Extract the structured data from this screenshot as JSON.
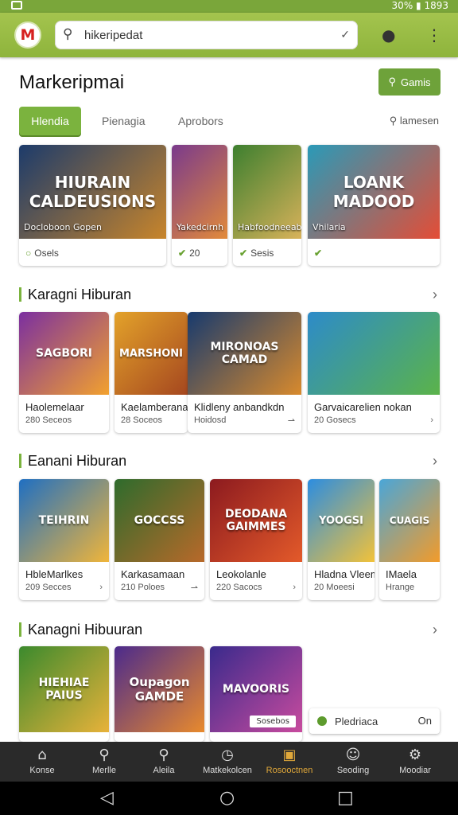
{
  "status": {
    "right": "30% ▮ 1893"
  },
  "app": {
    "logo_letter": "M",
    "search_value": "hikeripedat"
  },
  "page": {
    "title": "Markeripmai",
    "games_button": "Gamis"
  },
  "tabs": {
    "items": [
      "Hlendia",
      "Pienagia",
      "Aprobors"
    ],
    "right_label": "lamesen"
  },
  "featured": [
    {
      "art": "HIURAIN CALDEUSIONS",
      "art_label": "Docloboon Gopen",
      "footer": "Osels",
      "colors": [
        "#1c3b6b",
        "#c8852b"
      ]
    },
    {
      "art": "",
      "art_label": "Yakedcirnh",
      "footer": "20",
      "colors": [
        "#7a3a8c",
        "#e28a3a"
      ]
    },
    {
      "art": "",
      "art_label": "Habfoodneeab",
      "footer": "Sesis",
      "colors": [
        "#3d7f2f",
        "#d8b25a"
      ]
    },
    {
      "art": "LOANK MADOOD",
      "art_label": "Vhilaria",
      "footer": "",
      "colors": [
        "#2a9ab8",
        "#e44d36"
      ]
    }
  ],
  "sections": [
    {
      "title": "Karagni Hiburan",
      "cards": [
        {
          "art": "SAGBORI",
          "title": "Haolemelaar",
          "sub": "280 Seceos",
          "colors": [
            "#7b2fa0",
            "#f2a12e"
          ]
        },
        {
          "art": "MARSHONI",
          "title": "Kaelamberana",
          "sub": "28 Soceos",
          "colors": [
            "#e3a22a",
            "#a5471f"
          ]
        },
        {
          "art": "MIRONOAS CAMAD",
          "title": "Klidleny anbandkdn",
          "sub": "Hoidosd",
          "colors": [
            "#173a6e",
            "#d88a2d"
          ]
        },
        {
          "art": "",
          "title": "Garvaicarelien nokan",
          "sub": "20 Gosecs",
          "colors": [
            "#2d8bc9",
            "#5bb34a"
          ]
        }
      ]
    },
    {
      "title": "Eanani Hiburan",
      "cards": [
        {
          "art": "TEIHRIN",
          "title": "HbleMarlkes",
          "sub": "209 Secces",
          "colors": [
            "#1f6fc2",
            "#f0b53a"
          ]
        },
        {
          "art": "GOCCSS",
          "title": "Karkasamaan",
          "sub": "210 Poloes",
          "colors": [
            "#2e6b2c",
            "#b8692a"
          ]
        },
        {
          "art": "DEODANA GAIMMES",
          "title": "Leokolanle",
          "sub": "220 Sacocs",
          "colors": [
            "#8c1a1f",
            "#e35a2a"
          ]
        },
        {
          "art": "YOOGSI",
          "title": "Hladna Vleems",
          "sub": "20 Moeesi",
          "colors": [
            "#2c8de0",
            "#f2c23a"
          ]
        },
        {
          "art": "CUAGIS",
          "title": "IMaela",
          "sub": "Hrange",
          "colors": [
            "#4aa6d8",
            "#f29b2a"
          ]
        }
      ]
    },
    {
      "title": "Kanagni Hibuuran",
      "cards": [
        {
          "art": "HIEHIAE PAIUS",
          "title": "",
          "sub": "",
          "colors": [
            "#3b8a2d",
            "#e8b23a"
          ]
        },
        {
          "art": "Oupagon GAMDE",
          "title": "",
          "sub": "",
          "colors": [
            "#4b2a8c",
            "#e88a2d"
          ]
        },
        {
          "art": "MAVOORIS",
          "title": "",
          "sub": "",
          "colors": [
            "#3a2a8c",
            "#c84b9e"
          ],
          "badge": "Sosebos"
        }
      ]
    }
  ],
  "floating": {
    "label": "Pledriaca",
    "toggle": "On"
  },
  "bottom_nav": [
    "Konse",
    "Merlle",
    "Aleila",
    "Matkekolcen",
    "Rosooctnen",
    "Seoding",
    "Moodiar"
  ],
  "colors": {
    "accent": "#7bb33e",
    "appbar": "#9bbf47",
    "nav_bg": "#2a2a2a",
    "nav_active": "#e0a83a"
  }
}
